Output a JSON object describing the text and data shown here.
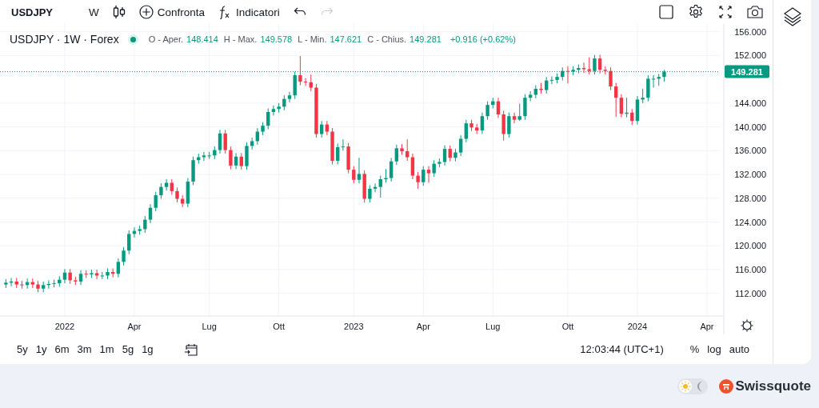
{
  "toolbar": {
    "symbol": "USDJPY",
    "interval": "W",
    "compare_label": "Confronta",
    "indicators_label": "Indicatori",
    "undo_disabled": false,
    "redo_disabled": true
  },
  "legend": {
    "title": "USDJPY · 1W · Forex",
    "fields": [
      {
        "label": "O - Aper.",
        "value": "148.414"
      },
      {
        "label": "H - Max.",
        "value": "149.578"
      },
      {
        "label": "L - Min.",
        "value": "147.621"
      },
      {
        "label": "C - Chius.",
        "value": "149.281"
      }
    ],
    "change": "+0.916 (+0.62%)"
  },
  "chart": {
    "chart_data": {
      "type": "candlestick",
      "grid": true,
      "ylim": [
        108.2,
        157.3
      ],
      "yticks": [
        {
          "value": 112,
          "label": "112.000"
        },
        {
          "value": 116,
          "label": "116.000"
        },
        {
          "value": 120,
          "label": "120.000"
        },
        {
          "value": 124,
          "label": "124.000"
        },
        {
          "value": 128,
          "label": "128.000"
        },
        {
          "value": 132,
          "label": "132.000"
        },
        {
          "value": 136,
          "label": "136.000"
        },
        {
          "value": 140,
          "label": "140.000"
        },
        {
          "value": 144,
          "label": "144.000"
        },
        {
          "value": 152,
          "label": "152.000"
        },
        {
          "value": 156,
          "label": "156.000"
        }
      ],
      "ref_lines": [
        {
          "axis": "y",
          "value": 149.281,
          "label": "149.281",
          "color": "#089981"
        }
      ],
      "categories": [
        null,
        null,
        null,
        null,
        null,
        null,
        null,
        null,
        null,
        null,
        null,
        "2022",
        null,
        null,
        null,
        null,
        null,
        null,
        null,
        null,
        null,
        null,
        null,
        null,
        "Apr",
        null,
        null,
        null,
        null,
        null,
        null,
        null,
        null,
        null,
        null,
        null,
        null,
        null,
        "Lug",
        null,
        null,
        null,
        null,
        null,
        null,
        null,
        null,
        null,
        null,
        null,
        null,
        "Ott",
        null,
        null,
        null,
        null,
        null,
        null,
        null,
        null,
        null,
        null,
        null,
        null,
        null,
        "2023",
        null,
        null,
        null,
        null,
        null,
        null,
        null,
        null,
        null,
        null,
        null,
        null,
        "Apr",
        null,
        null,
        null,
        null,
        null,
        null,
        null,
        null,
        null,
        null,
        null,
        null,
        "Lug",
        null,
        null,
        null,
        null,
        null,
        null,
        null,
        null,
        null,
        null,
        null,
        null,
        null,
        "Ott",
        null,
        null,
        null,
        null,
        null,
        null,
        null,
        null,
        null,
        null,
        null,
        null,
        "2024",
        null,
        null,
        null,
        null,
        null,
        null,
        null,
        null,
        null,
        null,
        null,
        null,
        "Apr"
      ],
      "ohlc": [
        [
          113.5,
          114.4,
          112.9,
          113.8
        ],
        [
          113.8,
          114.6,
          113.2,
          114.0
        ],
        [
          114.0,
          114.6,
          112.9,
          113.5
        ],
        [
          113.5,
          114.1,
          112.8,
          113.4
        ],
        [
          113.4,
          114.5,
          112.8,
          113.9
        ],
        [
          113.9,
          114.5,
          112.9,
          113.5
        ],
        [
          113.5,
          114.1,
          112.2,
          112.8
        ],
        [
          112.8,
          114.0,
          112.2,
          113.4
        ],
        [
          113.4,
          114.2,
          112.8,
          113.6
        ],
        [
          113.6,
          114.3,
          113.0,
          113.7
        ],
        [
          113.7,
          114.9,
          113.1,
          114.3
        ],
        [
          114.3,
          116.1,
          113.7,
          115.5
        ],
        [
          115.5,
          116.1,
          113.6,
          114.2
        ],
        [
          114.2,
          114.8,
          113.4,
          114.0
        ],
        [
          114.0,
          115.9,
          113.4,
          115.3
        ],
        [
          115.3,
          115.9,
          114.6,
          115.2
        ],
        [
          115.2,
          116.0,
          114.6,
          115.4
        ],
        [
          115.4,
          116.0,
          114.4,
          115.0
        ],
        [
          115.0,
          115.6,
          114.4,
          115.0
        ],
        [
          115.0,
          116.2,
          114.4,
          115.6
        ],
        [
          115.6,
          116.2,
          114.7,
          115.3
        ],
        [
          115.3,
          117.9,
          114.7,
          117.3
        ],
        [
          117.3,
          119.8,
          116.7,
          119.2
        ],
        [
          119.2,
          122.6,
          118.6,
          122.0
        ],
        [
          122.0,
          123.1,
          121.4,
          122.5
        ],
        [
          122.5,
          123.4,
          121.9,
          122.8
        ],
        [
          122.8,
          125.0,
          122.2,
          124.4
        ],
        [
          124.4,
          127.0,
          123.8,
          126.4
        ],
        [
          126.4,
          129.1,
          125.8,
          128.5
        ],
        [
          128.5,
          130.5,
          127.9,
          129.9
        ],
        [
          129.9,
          131.2,
          129.3,
          130.6
        ],
        [
          130.6,
          131.2,
          128.6,
          129.2
        ],
        [
          129.2,
          129.8,
          127.3,
          127.9
        ],
        [
          127.9,
          128.5,
          126.5,
          127.1
        ],
        [
          127.1,
          131.4,
          126.5,
          130.8
        ],
        [
          130.8,
          135.0,
          130.2,
          134.4
        ],
        [
          134.4,
          135.5,
          133.8,
          134.9
        ],
        [
          134.9,
          135.8,
          134.3,
          135.2
        ],
        [
          135.2,
          135.8,
          134.6,
          135.2
        ],
        [
          135.2,
          136.7,
          134.6,
          136.1
        ],
        [
          136.1,
          139.5,
          135.5,
          138.9
        ],
        [
          138.9,
          139.5,
          135.5,
          136.1
        ],
        [
          136.1,
          136.7,
          132.9,
          133.5
        ],
        [
          133.5,
          135.6,
          132.9,
          135.0
        ],
        [
          135.0,
          135.6,
          132.8,
          133.4
        ],
        [
          133.4,
          137.4,
          132.8,
          136.8
        ],
        [
          136.8,
          138.2,
          136.2,
          137.6
        ],
        [
          137.6,
          139.8,
          137.0,
          139.2
        ],
        [
          139.2,
          140.8,
          138.6,
          140.2
        ],
        [
          140.2,
          143.1,
          139.6,
          142.5
        ],
        [
          142.5,
          143.6,
          141.9,
          143.0
        ],
        [
          143.0,
          144.0,
          142.4,
          143.4
        ],
        [
          143.4,
          145.3,
          142.8,
          144.7
        ],
        [
          144.7,
          145.9,
          144.1,
          145.3
        ],
        [
          145.3,
          149.3,
          144.7,
          148.7
        ],
        [
          148.7,
          151.9,
          147.0,
          147.6
        ],
        [
          147.6,
          148.2,
          146.9,
          147.5
        ],
        [
          147.5,
          148.8,
          146.0,
          146.6
        ],
        [
          146.6,
          147.2,
          138.2,
          138.8
        ],
        [
          138.8,
          141.0,
          138.2,
          140.4
        ],
        [
          140.4,
          141.0,
          138.6,
          139.2
        ],
        [
          139.2,
          139.8,
          133.7,
          134.3
        ],
        [
          134.3,
          137.2,
          133.7,
          136.6
        ],
        [
          136.6,
          137.9,
          136.0,
          136.7
        ],
        [
          136.7,
          137.3,
          132.2,
          132.8
        ],
        [
          132.8,
          133.4,
          130.5,
          131.1
        ],
        [
          131.1,
          134.8,
          130.5,
          132.1
        ],
        [
          132.1,
          132.7,
          127.3,
          127.9
        ],
        [
          127.9,
          130.2,
          127.3,
          129.6
        ],
        [
          129.6,
          130.5,
          129.0,
          129.9
        ],
        [
          129.9,
          131.8,
          128.1,
          131.2
        ],
        [
          131.2,
          132.9,
          130.6,
          131.4
        ],
        [
          131.4,
          134.8,
          130.8,
          134.2
        ],
        [
          134.2,
          137.0,
          133.6,
          136.4
        ],
        [
          136.4,
          137.1,
          135.3,
          135.9
        ],
        [
          135.9,
          137.9,
          134.3,
          134.9
        ],
        [
          134.9,
          135.5,
          131.2,
          131.8
        ],
        [
          131.8,
          132.4,
          129.6,
          130.7
        ],
        [
          130.7,
          133.4,
          130.1,
          132.8
        ],
        [
          132.8,
          133.4,
          130.6,
          132.2
        ],
        [
          132.2,
          134.4,
          131.6,
          133.8
        ],
        [
          133.8,
          134.7,
          133.2,
          134.1
        ],
        [
          134.1,
          136.9,
          133.5,
          136.3
        ],
        [
          136.3,
          136.9,
          134.2,
          134.8
        ],
        [
          134.8,
          136.3,
          134.2,
          135.7
        ],
        [
          135.7,
          138.6,
          135.1,
          138.0
        ],
        [
          138.0,
          141.2,
          137.4,
          140.6
        ],
        [
          140.6,
          141.2,
          139.3,
          139.9
        ],
        [
          139.9,
          140.5,
          138.8,
          139.4
        ],
        [
          139.4,
          142.4,
          138.8,
          141.8
        ],
        [
          141.8,
          144.3,
          141.2,
          143.7
        ],
        [
          143.7,
          144.9,
          143.1,
          144.3
        ],
        [
          144.3,
          144.9,
          141.5,
          142.1
        ],
        [
          142.1,
          142.7,
          137.7,
          138.8
        ],
        [
          138.8,
          142.4,
          138.2,
          141.8
        ],
        [
          141.8,
          142.4,
          140.6,
          141.2
        ],
        [
          141.2,
          143.9,
          141.0,
          141.8
        ],
        [
          141.8,
          145.5,
          141.2,
          144.9
        ],
        [
          144.9,
          146.0,
          144.3,
          145.4
        ],
        [
          145.4,
          147.0,
          144.8,
          146.4
        ],
        [
          146.4,
          147.4,
          145.6,
          146.2
        ],
        [
          146.2,
          148.4,
          145.6,
          147.8
        ],
        [
          147.8,
          148.5,
          147.2,
          147.9
        ],
        [
          147.9,
          149.0,
          147.3,
          148.4
        ],
        [
          148.4,
          150.0,
          147.8,
          149.4
        ],
        [
          149.4,
          150.2,
          147.3,
          149.3
        ],
        [
          149.3,
          150.2,
          148.7,
          149.6
        ],
        [
          149.6,
          150.5,
          149.0,
          149.9
        ],
        [
          149.9,
          150.8,
          149.1,
          149.7
        ],
        [
          149.7,
          151.7,
          148.8,
          149.4
        ],
        [
          149.4,
          152.1,
          148.8,
          151.5
        ],
        [
          151.5,
          152.1,
          149.0,
          149.6
        ],
        [
          149.6,
          150.2,
          148.8,
          149.4
        ],
        [
          149.4,
          150.0,
          146.2,
          146.8
        ],
        [
          146.8,
          147.4,
          141.7,
          144.9
        ],
        [
          144.9,
          145.5,
          141.6,
          142.2
        ],
        [
          142.2,
          144.9,
          141.6,
          142.4
        ],
        [
          142.4,
          143.0,
          140.3,
          141.0
        ],
        [
          141.0,
          145.2,
          140.4,
          144.6
        ],
        [
          144.6,
          146.4,
          144.0,
          144.9
        ],
        [
          144.9,
          148.7,
          144.3,
          148.1
        ],
        [
          148.1,
          148.7,
          146.6,
          148.1
        ],
        [
          148.1,
          148.9,
          146.9,
          148.4
        ],
        [
          148.4,
          149.6,
          147.6,
          149.3
        ],
        null,
        null,
        null,
        null,
        null,
        null,
        null,
        null
      ]
    }
  },
  "bottom_bar": {
    "ranges": [
      "5y",
      "1y",
      "6m",
      "3m",
      "1m",
      "5g",
      "1g"
    ],
    "time": "12:03:44 (UTC+1)",
    "scale_options": [
      "%",
      "log",
      "auto"
    ]
  },
  "footer": {
    "light_theme": true,
    "brand": "Swissquote"
  }
}
